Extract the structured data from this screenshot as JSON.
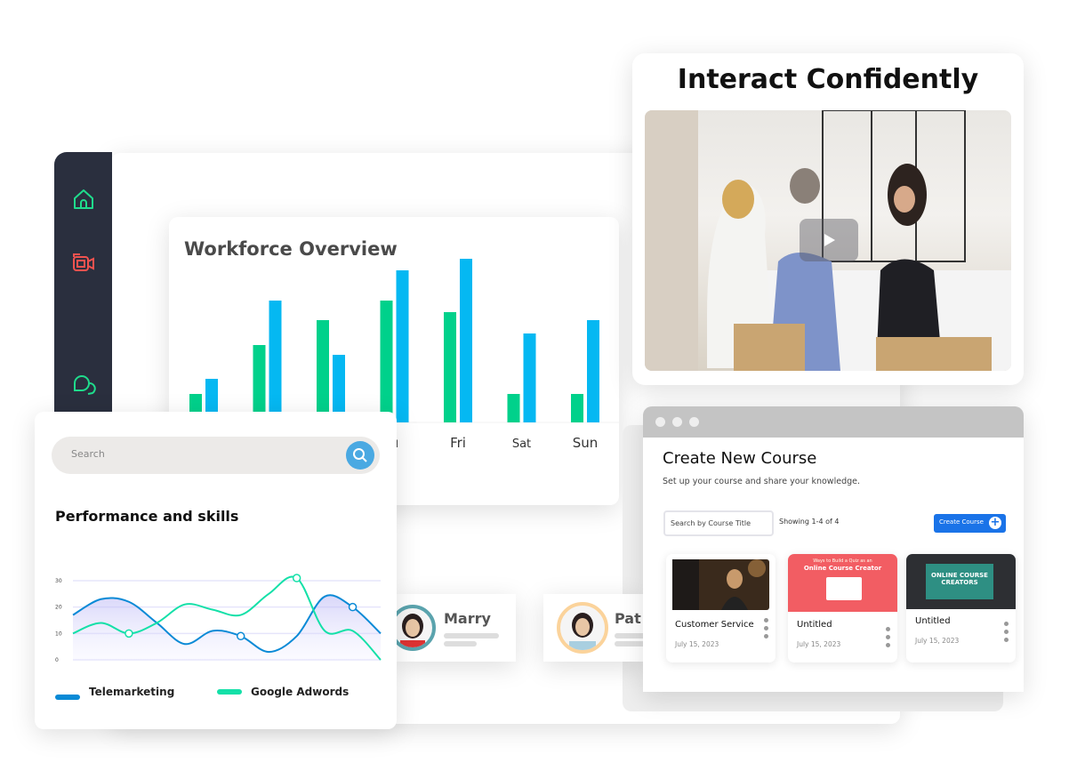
{
  "workforce": {
    "title": "Workforce Overview",
    "chart_data": {
      "type": "bar",
      "title": "Workforce Overview",
      "categories": [
        "",
        "",
        "",
        "u",
        "Fri",
        "Sat",
        "Sun"
      ],
      "series": [
        {
          "color": "#00d18b",
          "values": [
            32,
            87,
            115,
            137,
            124,
            32,
            32
          ]
        },
        {
          "color": "#05b8f2",
          "values": [
            49,
            137,
            76,
            171,
            184,
            100,
            115
          ]
        }
      ],
      "ylim": [
        0,
        190
      ],
      "grid": false
    }
  },
  "sidebar": {
    "icons": [
      {
        "name": "home-icon",
        "color": "#1fdc8c"
      },
      {
        "name": "video-camera-icon",
        "color": "#f0524f"
      },
      {
        "name": "chat-bubbles-icon",
        "color": "#1fdc8c"
      }
    ]
  },
  "performance": {
    "search_placeholder": "Search",
    "title": "Performance and skills",
    "chart_data": {
      "type": "line",
      "y_ticks": [
        "0",
        "10",
        "20",
        "30"
      ],
      "ylim": [
        0,
        30
      ],
      "grid": true,
      "legend_position": "bottom",
      "series": [
        {
          "name": "Telemarketing",
          "color": "#0a8ad6",
          "filled": true,
          "values": [
            17,
            23,
            22,
            14,
            6,
            11,
            9,
            3,
            9,
            24,
            20,
            10
          ],
          "markers": [
            6,
            10
          ]
        },
        {
          "name": "Google Adwords",
          "color": "#14e0a8",
          "filled": false,
          "values": [
            10,
            14,
            10,
            14,
            21,
            19,
            17,
            25,
            31,
            11,
            11,
            0
          ],
          "markers": [
            2,
            8
          ]
        }
      ]
    }
  },
  "people": [
    {
      "name": "Marry",
      "ring": "#5aa3ad"
    },
    {
      "name": "Pat",
      "ring": "#fbd39b"
    }
  ],
  "interact": {
    "title": "Interact Confidently"
  },
  "course": {
    "title": "Create New Course",
    "subtitle": "Set up your course and share your knowledge.",
    "search_placeholder": "Search by Course Title",
    "showing": "Showing 1-4 of 4",
    "create_label": "Create Course",
    "create_icon": "+",
    "cards": [
      {
        "title": "Customer Service",
        "date": "July 15, 2023"
      },
      {
        "title": "Untitled",
        "date": "July 15, 2023",
        "thumb_line1": "Ways to Build a Quiz as an",
        "thumb_line2": "Online Course Creator"
      },
      {
        "title": "Untitled",
        "date": "July 15, 2023",
        "thumb_line1": "ONLINE COURSE",
        "thumb_line2": "CREATORS"
      }
    ]
  }
}
